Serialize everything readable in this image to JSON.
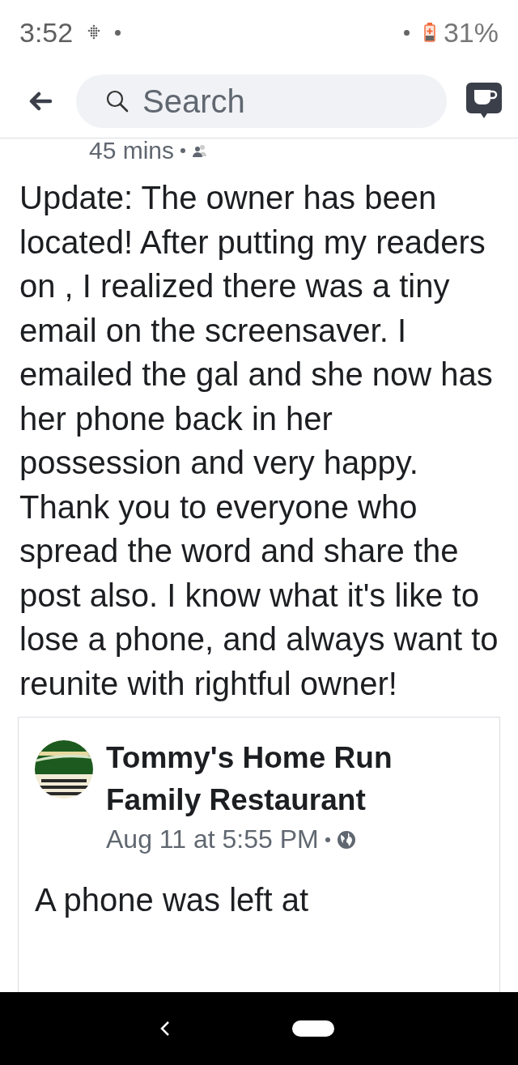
{
  "status_bar": {
    "time": "3:52",
    "battery": "31%"
  },
  "header": {
    "search": {
      "placeholder": "Search"
    }
  },
  "post": {
    "time_ago": "45 mins",
    "text": "Update: The owner has been located! After putting my readers on , I realized there was a tiny email on the screensaver. I emailed the gal and she now has her phone back in her possession and very happy. Thank you to everyone who spread the word and share the post also. I know what it's like to lose a phone, and always want to reunite with rightful owner!"
  },
  "shared_post": {
    "page_name": "Tommy's Home Run Family Restaurant",
    "time": "Aug 11 at 5:55 PM",
    "text": "A phone was left at"
  }
}
